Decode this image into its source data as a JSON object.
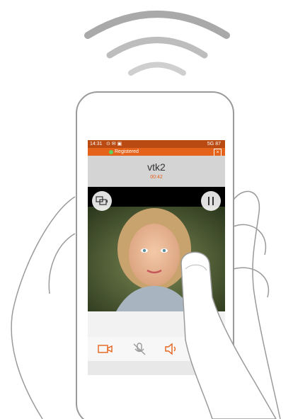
{
  "statusbar": {
    "time": "14:31",
    "network": "5G",
    "battery": "87"
  },
  "registration": {
    "status": "Registered",
    "status_color": "#5fd35f",
    "close_icon": "close-icon"
  },
  "call": {
    "contact_name": "vtk2",
    "duration": "00:42"
  },
  "video": {
    "switch_camera_icon": "switch-camera-icon",
    "pause_icon": "pause-icon"
  },
  "controls": {
    "items": [
      "video-camera-icon",
      "mute-mic-icon",
      "speaker-icon"
    ]
  },
  "colors": {
    "accent": "#e5621a",
    "status_bar": "#b84a12",
    "header_gray": "#d4d4d4"
  }
}
